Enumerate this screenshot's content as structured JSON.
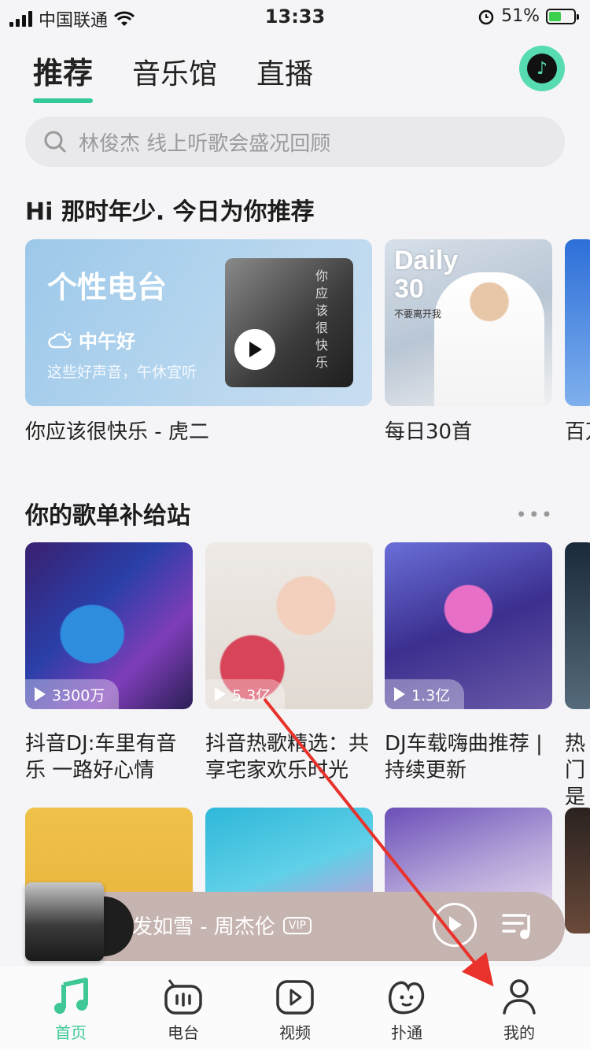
{
  "status": {
    "carrier": "中国联通",
    "time": "13:33",
    "battery": "51%",
    "battery_level": 0.51
  },
  "top_tabs": [
    {
      "label": "推荐"
    },
    {
      "label": "音乐馆"
    },
    {
      "label": "直播"
    }
  ],
  "search": {
    "placeholder": "林俊杰  线上听歌会盛况回顾"
  },
  "recommend": {
    "title": "Hi 那时年少. 今日为你推荐",
    "radio_card": {
      "title": "个性电台",
      "greeting": "中午好",
      "subtitle": "这些好声音，午休宜听",
      "cover_text": "你应该很快乐"
    },
    "radio_caption": "你应该很快乐 - 虎二",
    "daily_card": {
      "line1": "Daily",
      "line2": "30",
      "sub": "不要离开我"
    },
    "daily_caption": "每日30首",
    "partial_caption": "百万"
  },
  "playlists": {
    "title": "你的歌单补给站",
    "items": [
      {
        "count": "3300万",
        "title": "抖音DJ:车里有音乐 一路好心情"
      },
      {
        "count": "5.3亿",
        "title": "抖音热歌精选：共享宅家欢乐时光"
      },
      {
        "count": "1.3亿",
        "title": "DJ车载嗨曲推荐 | 持续更新"
      },
      {
        "count": "",
        "title": "热门是不"
      }
    ]
  },
  "player": {
    "song": "发如雪 - 周杰伦",
    "vip": "VIP"
  },
  "tabbar": [
    {
      "label": "首页"
    },
    {
      "label": "电台"
    },
    {
      "label": "视频"
    },
    {
      "label": "扑通"
    },
    {
      "label": "我的"
    }
  ],
  "colors": {
    "accent": "#35c99a",
    "arrow": "#e8322b"
  }
}
